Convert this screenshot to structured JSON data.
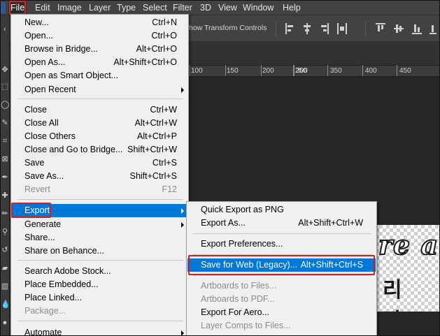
{
  "menubar": {
    "items": [
      "File",
      "Edit",
      "Image",
      "Layer",
      "Type",
      "Select",
      "Filter",
      "3D",
      "View",
      "Window",
      "Help"
    ]
  },
  "options_bar": {
    "transform_label": "how Transform Controls"
  },
  "ruler": {
    "labels": [
      "100",
      "150",
      "200",
      "250",
      "300",
      "350",
      "400",
      "450"
    ]
  },
  "canvas": {
    "line1": "re a",
    "line2": "리 바"
  },
  "file_menu": {
    "items": [
      {
        "label": "New...",
        "shortcut": "Ctrl+N"
      },
      {
        "label": "Open...",
        "shortcut": "Ctrl+O"
      },
      {
        "label": "Browse in Bridge...",
        "shortcut": "Alt+Ctrl+O"
      },
      {
        "label": "Open As...",
        "shortcut": "Alt+Shift+Ctrl+O"
      },
      {
        "label": "Open as Smart Object...",
        "shortcut": ""
      },
      {
        "label": "Open Recent",
        "shortcut": ""
      },
      {
        "label": "Close",
        "shortcut": "Ctrl+W"
      },
      {
        "label": "Close All",
        "shortcut": "Alt+Ctrl+W"
      },
      {
        "label": "Close Others",
        "shortcut": "Alt+Ctrl+P"
      },
      {
        "label": "Close and Go to Bridge...",
        "shortcut": "Shift+Ctrl+W"
      },
      {
        "label": "Save",
        "shortcut": "Ctrl+S"
      },
      {
        "label": "Save As...",
        "shortcut": "Shift+Ctrl+S"
      },
      {
        "label": "Revert",
        "shortcut": "F12"
      },
      {
        "label": "Export",
        "shortcut": ""
      },
      {
        "label": "Generate",
        "shortcut": ""
      },
      {
        "label": "Share...",
        "shortcut": ""
      },
      {
        "label": "Share on Behance...",
        "shortcut": ""
      },
      {
        "label": "Search Adobe Stock...",
        "shortcut": ""
      },
      {
        "label": "Place Embedded...",
        "shortcut": ""
      },
      {
        "label": "Place Linked...",
        "shortcut": ""
      },
      {
        "label": "Package...",
        "shortcut": ""
      },
      {
        "label": "Automate",
        "shortcut": ""
      }
    ]
  },
  "export_menu": {
    "items": [
      {
        "label": "Quick Export as PNG",
        "shortcut": ""
      },
      {
        "label": "Export As...",
        "shortcut": "Alt+Shift+Ctrl+W"
      },
      {
        "label": "Export Preferences...",
        "shortcut": ""
      },
      {
        "label": "Save for Web (Legacy)...",
        "shortcut": "Alt+Shift+Ctrl+S"
      },
      {
        "label": "Artboards to Files...",
        "shortcut": ""
      },
      {
        "label": "Artboards to PDF...",
        "shortcut": ""
      },
      {
        "label": "Export For Aero...",
        "shortcut": ""
      },
      {
        "label": "Layer Comps to Files...",
        "shortcut": ""
      }
    ]
  },
  "colors": {
    "highlight": "#0078d7",
    "annotation_red": "#d62020",
    "menu_bg": "#f0f0f0",
    "ui_dark": "#424242"
  }
}
